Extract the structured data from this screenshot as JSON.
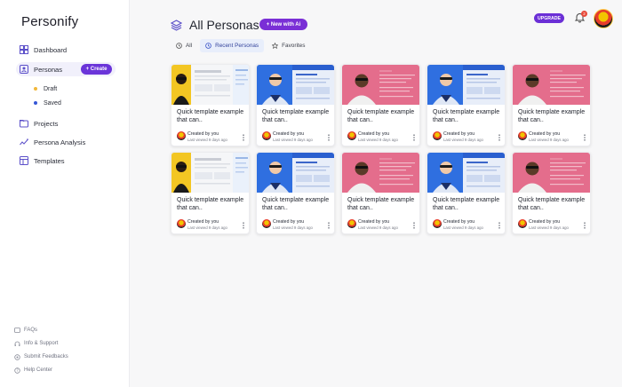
{
  "app": {
    "logo": "Personify"
  },
  "sidebar": {
    "nav": [
      {
        "id": "dashboard",
        "label": "Dashboard",
        "icon": "grid-icon"
      },
      {
        "id": "personas",
        "label": "Personas",
        "icon": "persona-icon",
        "active": true
      },
      {
        "id": "projects",
        "label": "Projects",
        "icon": "folder-icon"
      },
      {
        "id": "persona-analysis",
        "label": "Persona Analysis",
        "icon": "analytics-icon"
      },
      {
        "id": "templates",
        "label": "Templates",
        "icon": "template-icon"
      }
    ],
    "create_label": "+ Create",
    "sub_items": [
      {
        "label": "Draft",
        "color": "#f1b73a"
      },
      {
        "label": "Saved",
        "color": "#3557d6"
      }
    ],
    "footer": [
      {
        "label": "FAQs",
        "icon": "faq-icon"
      },
      {
        "label": "Info & Support",
        "icon": "headset-icon"
      },
      {
        "label": "Submit Feedbacks",
        "icon": "feedback-icon"
      },
      {
        "label": "Help Center",
        "icon": "help-icon"
      }
    ]
  },
  "header": {
    "title": "All Personas",
    "ai_button": "+ New with Ai",
    "upgrade": "UPGRADE",
    "notification_count": "2"
  },
  "tabs": [
    {
      "label": "All",
      "icon": "clock-icon"
    },
    {
      "label": "Recent Personas",
      "icon": "clock-icon",
      "active": true
    },
    {
      "label": "Favorites",
      "icon": "star-icon"
    }
  ],
  "cards": [
    {
      "title": "Quick template example that can..",
      "created": "Created by you",
      "viewed": "Last viewed 9 days ago",
      "thumb": "white"
    },
    {
      "title": "Quick template example that can..",
      "created": "Created by you",
      "viewed": "Last viewed 9 days ago",
      "thumb": "blue"
    },
    {
      "title": "Quick template example that can..",
      "created": "Created by you",
      "viewed": "Last viewed 9 days ago",
      "thumb": "pink"
    },
    {
      "title": "Quick template example that can..",
      "created": "Created by you",
      "viewed": "Last viewed 9 days ago",
      "thumb": "blue"
    },
    {
      "title": "Quick template example that can..",
      "created": "Created by you",
      "viewed": "Last viewed 9 days ago",
      "thumb": "pink"
    },
    {
      "title": "Quick template example that can..",
      "created": "Created by you",
      "viewed": "Last viewed 9 days ago",
      "thumb": "white"
    },
    {
      "title": "Quick template example that can..",
      "created": "Created by you",
      "viewed": "Last viewed 9 days ago",
      "thumb": "blue"
    },
    {
      "title": "Quick template example that can..",
      "created": "Created by you",
      "viewed": "Last viewed 9 days ago",
      "thumb": "pink"
    },
    {
      "title": "Quick template example that can..",
      "created": "Created by you",
      "viewed": "Last viewed 9 days ago",
      "thumb": "blue"
    },
    {
      "title": "Quick template example that can..",
      "created": "Created by you",
      "viewed": "Last viewed 9 days ago",
      "thumb": "pink"
    }
  ],
  "colors": {
    "accent": "#6b35d9",
    "blue_thumb": "#2f6fe0",
    "pink_thumb": "#e46d8c",
    "yellow_thumb": "#f3c623"
  }
}
